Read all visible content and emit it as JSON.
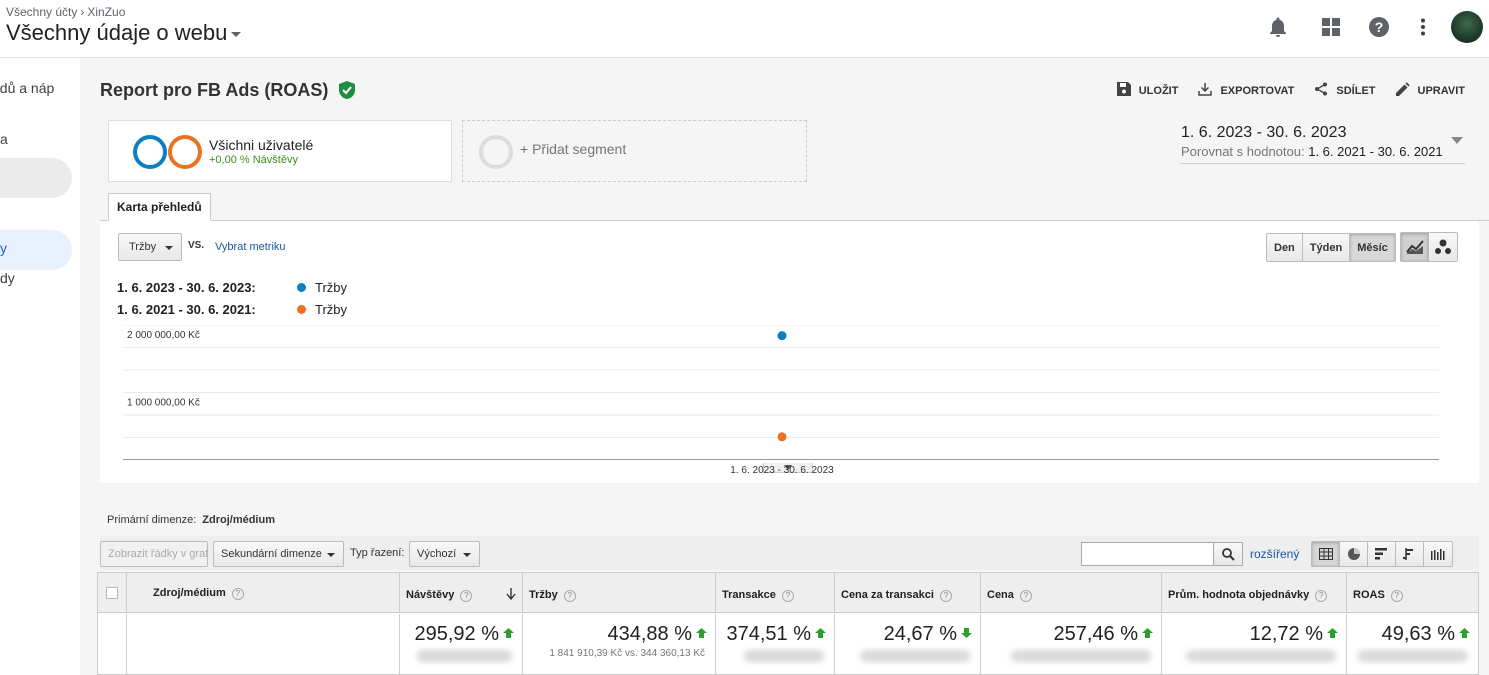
{
  "header": {
    "breadcrumb": [
      "Všechny účty",
      "XinZuo"
    ],
    "view_title": "Všechny údaje o webu",
    "icons": [
      "bell-icon",
      "apps-grid-icon",
      "help-icon",
      "more-vert-icon"
    ]
  },
  "leftnav": {
    "items": [
      "edů a náp",
      "a",
      "y",
      "dy"
    ],
    "active_index": 2
  },
  "report": {
    "title": "Report pro FB Ads (ROAS)",
    "verified_icon": "shield-check-icon",
    "actions": {
      "save": "ULOŽIT",
      "export": "EXPORTOVAT",
      "share": "SDÍLET",
      "edit": "UPRAVIT"
    }
  },
  "segments": {
    "current_name": "Všichni uživatelé",
    "current_sub": "+0,00 % Návštěvy",
    "add_label": "+ Přidat segment",
    "colors": [
      "#0b7fc0",
      "#ea7323"
    ]
  },
  "date_range": {
    "main": "1. 6. 2023 - 30. 6. 2023",
    "compare_label": "Porovnat s hodnotou:",
    "compare_value": "1. 6. 2021 - 30. 6. 2021"
  },
  "tabs": [
    "Karta přehledů"
  ],
  "chart_controls": {
    "metric": "Tržby",
    "vs": "VS.",
    "pick_metric": "Vybrat metriku",
    "granularity": [
      "Den",
      "Týden",
      "Měsíc"
    ],
    "active_granularity": "Měsíc"
  },
  "chart_data": {
    "type": "scatter",
    "x": [
      "1. 6. 2023 - 30. 6. 2023"
    ],
    "series": [
      {
        "name": "Tržby",
        "range": "1. 6. 2023 - 30. 6. 2023:",
        "values": [
          1841910.39
        ],
        "color": "#0b7fc0"
      },
      {
        "name": "Tržby",
        "range": "1. 6. 2021 - 30. 6. 2021:",
        "values": [
          344360.13
        ],
        "color": "#ea7323"
      }
    ],
    "ylim": [
      0,
      2000000
    ],
    "yticks": [
      {
        "value": 2000000,
        "label": "2 000 000,00 Kč"
      },
      {
        "value": 1000000,
        "label": "1 000 000,00 Kč"
      }
    ],
    "xlabel": "",
    "ylabel": "",
    "grid": true
  },
  "table_controls": {
    "primary_dim_label": "Primární dimenze:",
    "primary_dim_value": "Zdroj/médium",
    "show_rows": "Zobrazit řádky v grafu",
    "secondary_dim": "Sekundární dimenze",
    "sort_label": "Typ řazení:",
    "sort_value": "Výchozí",
    "advanced": "rozšířený",
    "search_value": ""
  },
  "table": {
    "columns": [
      "Zdroj/médium",
      "Návštěvy",
      "Tržby",
      "Transakce",
      "Cena za transakci",
      "Cena",
      "Prům. hodnota objednávky",
      "ROAS"
    ],
    "totals": [
      {
        "pct": "295,92 %",
        "dir": "up"
      },
      {
        "pct": "434,88 %",
        "dir": "up",
        "sub": "1 841 910,39 Kč vs. 344 360,13 Kč"
      },
      {
        "pct": "374,51 %",
        "dir": "up"
      },
      {
        "pct": "24,67 %",
        "dir": "down"
      },
      {
        "pct": "257,46 %",
        "dir": "up"
      },
      {
        "pct": "12,72 %",
        "dir": "up"
      },
      {
        "pct": "49,63 %",
        "dir": "up"
      }
    ]
  }
}
